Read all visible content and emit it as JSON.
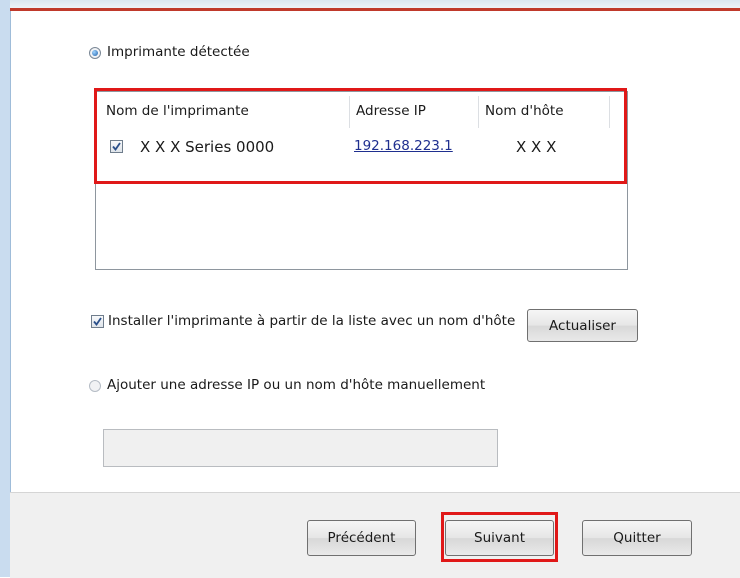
{
  "detected": {
    "radio_label": "Imprimante détectée",
    "selected": true
  },
  "printer_list": {
    "columns": [
      "Nom de l'imprimante",
      "Adresse IP",
      "Nom d'hôte"
    ],
    "rows": [
      {
        "checked": true,
        "name": "X X X  Series 0000",
        "ip": "192.168.223.1",
        "hostname": "X X X"
      }
    ]
  },
  "install_option": {
    "label": "Installer l'imprimante à partir de la liste avec un nom d'hôte",
    "checked": true,
    "refresh_label": "Actualiser"
  },
  "manual": {
    "radio_label": "Ajouter une adresse IP ou un nom d'hôte manuellement",
    "selected": false,
    "input_value": ""
  },
  "buttons": {
    "previous": "Précédent",
    "next": "Suivant",
    "quit": "Quitter"
  },
  "colors": {
    "highlight": "#e01818",
    "link": "#1f2f8f",
    "accent": "#c0392b"
  }
}
